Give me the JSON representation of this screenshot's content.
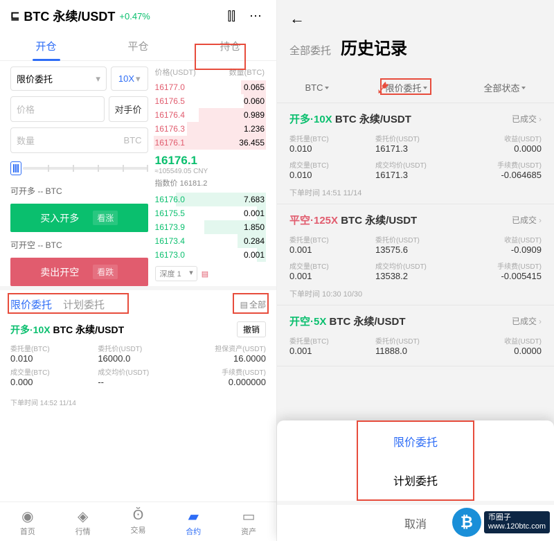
{
  "left": {
    "header": {
      "pair": "BTC 永续/USDT",
      "change": "+0.47%"
    },
    "tabs": [
      "开仓",
      "平仓",
      "持仓"
    ],
    "order_type": "限价委托",
    "leverage": "10X",
    "price_placeholder": "价格",
    "counterparty": "对手价",
    "qty_placeholder": "数量",
    "qty_unit": "BTC",
    "avail_long": "可开多 -- BTC",
    "avail_short": "可开空 -- BTC",
    "buy_label": "买入开多",
    "buy_sub": "看涨",
    "sell_label": "卖出开空",
    "sell_sub": "看跌",
    "book_header": {
      "price": "价格(USDT)",
      "amount": "数量(BTC)"
    },
    "asks": [
      {
        "p": "16177.0",
        "a": "0.065",
        "w": 22
      },
      {
        "p": "16176.5",
        "a": "0.060",
        "w": 20
      },
      {
        "p": "16176.4",
        "a": "0.989",
        "w": 60
      },
      {
        "p": "16176.3",
        "a": "1.236",
        "w": 70
      },
      {
        "p": "16176.1",
        "a": "36.455",
        "w": 100
      }
    ],
    "mid": {
      "price": "16176.1",
      "fiat": "≈105549.05 CNY",
      "index": "指数价 16181.2"
    },
    "bids": [
      {
        "p": "16176.0",
        "a": "7.683",
        "w": 80
      },
      {
        "p": "16175.5",
        "a": "0.001",
        "w": 8
      },
      {
        "p": "16173.9",
        "a": "1.850",
        "w": 55
      },
      {
        "p": "16173.4",
        "a": "0.284",
        "w": 25
      },
      {
        "p": "16173.0",
        "a": "0.001",
        "w": 8
      }
    ],
    "depth_label": "深度 1",
    "order_tabs": [
      "限价委托",
      "计划委托"
    ],
    "all_label": "全部",
    "open_order": {
      "name_prefix": "开多·10X",
      "name_pair": "BTC 永续/USDT",
      "cancel": "撤销",
      "fields": {
        "amt_lbl": "委托量(BTC)",
        "amt": "0.010",
        "price_lbl": "委托价(USDT)",
        "price": "16000.0",
        "margin_lbl": "担保资产(USDT)",
        "margin": "16.0000",
        "filled_lbl": "成交量(BTC)",
        "filled": "0.000",
        "avg_lbl": "成交均价(USDT)",
        "avg": "--",
        "fee_lbl": "手续费(USDT)",
        "fee": "0.000000"
      },
      "time": "下单时间 14:52 11/14"
    },
    "nav": [
      {
        "icon": "◎",
        "label": "首页"
      },
      {
        "icon": "◇",
        "label": "行情"
      },
      {
        "icon": "⇄",
        "label": "交易"
      },
      {
        "icon": "▤",
        "label": "合约"
      },
      {
        "icon": "▢",
        "label": "资产"
      }
    ]
  },
  "right": {
    "title_sub": "全部委托",
    "title_main": "历史记录",
    "filters": [
      "BTC",
      "限价委托",
      "全部状态"
    ],
    "orders": [
      {
        "side": "long",
        "side_label": "开多·10X",
        "pair": "BTC 永续/USDT",
        "status": "已成交",
        "amt_lbl": "委托量(BTC)",
        "amt": "0.010",
        "price_lbl": "委托价(USDT)",
        "price": "16171.3",
        "pnl_lbl": "收益(USDT)",
        "pnl": "0.0000",
        "filled_lbl": "成交量(BTC)",
        "filled": "0.010",
        "avg_lbl": "成交均价(USDT)",
        "avg": "16171.3",
        "fee_lbl": "手续费(USDT)",
        "fee": "-0.064685",
        "time": "下单时间 14:51 11/14"
      },
      {
        "side": "short",
        "side_label": "平空·125X",
        "pair": "BTC 永续/USDT",
        "status": "已成交",
        "amt_lbl": "委托量(BTC)",
        "amt": "0.001",
        "price_lbl": "委托价(USDT)",
        "price": "13575.6",
        "pnl_lbl": "收益(USDT)",
        "pnl": "-0.0909",
        "filled_lbl": "成交量(BTC)",
        "filled": "0.001",
        "avg_lbl": "成交均价(USDT)",
        "avg": "13538.2",
        "fee_lbl": "手续费(USDT)",
        "fee": "-0.005415",
        "time": "下单时间 10:30 10/30"
      },
      {
        "side": "long",
        "side_label": "开空·5X",
        "pair": "BTC 永续/USDT",
        "status": "已成交",
        "amt_lbl": "委托量(BTC)",
        "amt": "0.001",
        "price_lbl": "委托价(USDT)",
        "price": "11888.0",
        "pnl_lbl": "收益(USDT)",
        "pnl": "0.0000"
      }
    ],
    "popup": {
      "opt1": "限价委托",
      "opt2": "计划委托",
      "cancel": "取消"
    },
    "watermark": {
      "name": "币圈子",
      "url": "www.120btc.com"
    }
  }
}
